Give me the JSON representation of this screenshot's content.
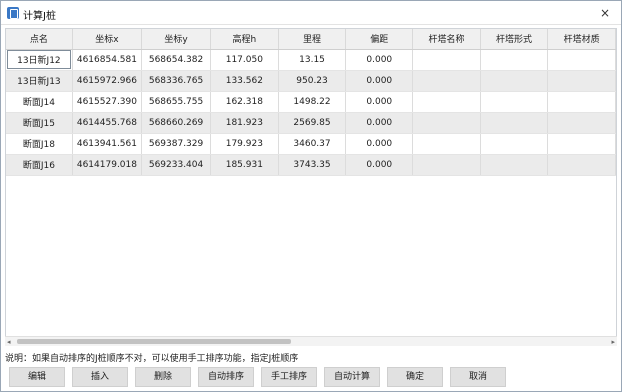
{
  "window": {
    "title": "计算J桩",
    "close_label": "×"
  },
  "table": {
    "columns": [
      "点名",
      "坐标x",
      "坐标y",
      "高程h",
      "里程",
      "偏距",
      "杆塔名称",
      "杆塔形式",
      "杆塔材质"
    ],
    "rows": [
      [
        "13日新J12",
        "4616854.581",
        "568654.382",
        "117.050",
        "13.15",
        "0.000",
        "",
        "",
        ""
      ],
      [
        "13日新J13",
        "4615972.966",
        "568336.765",
        "133.562",
        "950.23",
        "0.000",
        "",
        "",
        ""
      ],
      [
        "断面J14",
        "4615527.390",
        "568655.755",
        "162.318",
        "1498.22",
        "0.000",
        "",
        "",
        ""
      ],
      [
        "断面J15",
        "4614455.768",
        "568660.269",
        "181.923",
        "2569.85",
        "0.000",
        "",
        "",
        ""
      ],
      [
        "断面J18",
        "4613941.561",
        "569387.329",
        "179.923",
        "3460.37",
        "0.000",
        "",
        "",
        ""
      ],
      [
        "断面J16",
        "4614179.018",
        "569233.404",
        "185.931",
        "3743.35",
        "0.000",
        "",
        "",
        ""
      ]
    ]
  },
  "scrollbar": {
    "left_arrow": "◂",
    "right_arrow": "▸"
  },
  "note": "说明：如果自动排序的J桩顺序不对，可以使用手工排序功能，指定J桩顺序",
  "buttons": {
    "edit": "编辑",
    "insert": "插入",
    "delete": "删除",
    "auto_sort": "自动排序",
    "manual_sort": "手工排序",
    "auto_calc": "自动计算",
    "ok": "确定",
    "cancel": "取消"
  }
}
